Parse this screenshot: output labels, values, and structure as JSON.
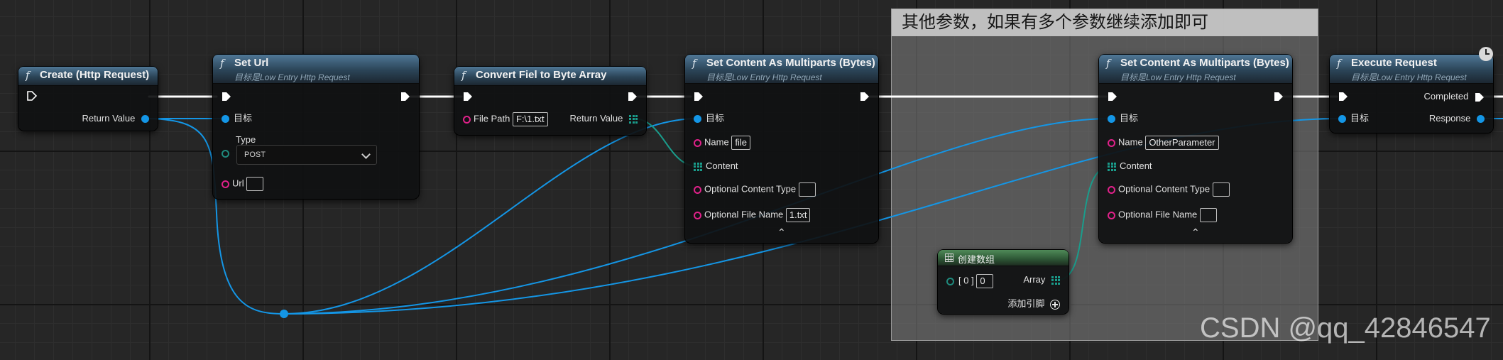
{
  "comment": {
    "text": "其他参数，如果有多个参数继续添加即可"
  },
  "colors": {
    "exec": "#ffffff",
    "object": "#1496e6",
    "string": "#e0218a",
    "byte_array": "#1a9d8c",
    "header": "#2b4457"
  },
  "nodes": {
    "create": {
      "title": "Create (Http Request)",
      "return_label": "Return Value"
    },
    "seturl": {
      "title": "Set Url",
      "subtitle": "目标是Low Entry Http Request",
      "target_label": "目标",
      "type_label": "Type",
      "type_value": "POST",
      "url_label": "Url",
      "url_value": ""
    },
    "convert": {
      "title": "Convert Fiel to Byte Array",
      "filepath_label": "File Path",
      "filepath_value": "F:\\1.txt",
      "return_label": "Return Value"
    },
    "setcontent1": {
      "title": "Set Content As Multiparts (Bytes)",
      "subtitle": "目标是Low Entry Http Request",
      "target_label": "目标",
      "name_label": "Name",
      "name_value": "file",
      "content_label": "Content",
      "oct_label": "Optional Content Type",
      "oct_value": "",
      "ofn_label": "Optional File Name",
      "ofn_value": "1.txt"
    },
    "setcontent2": {
      "title": "Set Content As Multiparts (Bytes)",
      "subtitle": "目标是Low Entry Http Request",
      "target_label": "目标",
      "name_label": "Name",
      "name_value": "OtherParameter",
      "content_label": "Content",
      "oct_label": "Optional Content Type",
      "oct_value": "",
      "ofn_label": "Optional File Name",
      "ofn_value": ""
    },
    "makearray": {
      "title": "创建数组",
      "index_label": "[ 0 ]",
      "index_value": "0",
      "array_label": "Array",
      "add_pin_label": "添加引脚"
    },
    "execute": {
      "title": "Execute Request",
      "subtitle": "目标是Low Entry Http Request",
      "completed_label": "Completed",
      "target_label": "目标",
      "response_label": "Response"
    }
  },
  "watermark": {
    "text": "CSDN @qq_42846547"
  }
}
